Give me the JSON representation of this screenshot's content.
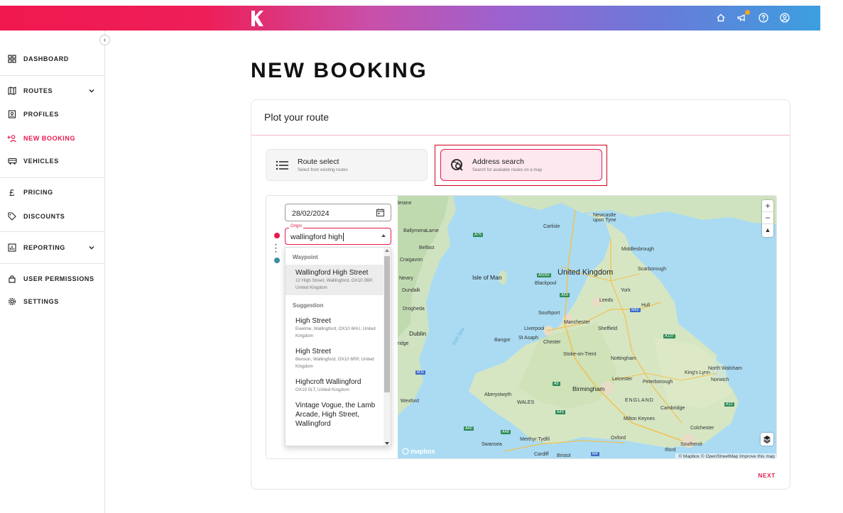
{
  "topbar": {
    "logo_letter": "K",
    "icons": [
      "home-icon",
      "megaphone-icon",
      "help-icon",
      "account-icon"
    ]
  },
  "sidebar": {
    "collapse_icon": "chevron-left-icon",
    "items": [
      {
        "label": "DASHBOARD",
        "icon": "dashboard-icon"
      },
      {
        "label": "ROUTES",
        "icon": "map-icon",
        "expandable": true
      },
      {
        "label": "PROFILES",
        "icon": "profile-icon"
      },
      {
        "label": "NEW BOOKING",
        "icon": "add-user-icon",
        "active": true
      },
      {
        "label": "VEHICLES",
        "icon": "bus-icon"
      },
      {
        "label": "PRICING",
        "icon": "pound-icon"
      },
      {
        "label": "DISCOUNTS",
        "icon": "tag-icon"
      },
      {
        "label": "REPORTING",
        "icon": "report-icon",
        "expandable": true
      },
      {
        "label": "USER PERMISSIONS",
        "icon": "lock-icon"
      },
      {
        "label": "SETTINGS",
        "icon": "gear-icon"
      }
    ]
  },
  "page": {
    "title": "NEW BOOKING"
  },
  "card": {
    "heading": "Plot your route",
    "options": {
      "route_select": {
        "title": "Route select",
        "subtitle": "Select from existing routes"
      },
      "address_search": {
        "title": "Address search",
        "subtitle": "Search for available routes on a map",
        "selected": true
      }
    },
    "next_label": "NEXT"
  },
  "form": {
    "date_value": "28/02/2024",
    "origin_label": "Origin",
    "origin_value": "wallingford high"
  },
  "dropdown": {
    "group_waypoint": "Waypoint",
    "waypoint": {
      "main": "Wallingford High Street",
      "sub": "12 High Street, Wallingford, OX10 0BP, United Kingdom"
    },
    "group_suggestion": "Suggestion",
    "suggestions": [
      {
        "main": "High Street",
        "sub": "Ewelme, Wallingford, OX10 6HU, United Kingdom"
      },
      {
        "main": "High Street",
        "sub": "Benson, Wallingford, OX10 6RP, United Kingdom"
      },
      {
        "main": "Highcroft Wallingford",
        "sub": "OX10 0LT, United Kingdom"
      },
      {
        "main": "Vintage Vogue, the Lamb Arcade, High Street, Wallingford",
        "sub": ""
      }
    ]
  },
  "map": {
    "labels": {
      "country": "United Kingdom",
      "isle_of_man": "Isle of Man",
      "irish_sea": "Irish Sea",
      "dublin": "Dublin",
      "birmingham": "Birmingham",
      "manchester": "Manchester",
      "liverpool": "Liverpool",
      "leeds": "Leeds",
      "york": "York",
      "sheffield": "Sheffield",
      "hull": "Hull",
      "newcastle": "Newcastle upon Tyne",
      "carlisle": "Carlisle",
      "middlesbrough": "Middlesbrough",
      "scarborough": "Scarborough",
      "blackpool": "Blackpool",
      "southport": "Southport",
      "belfast": "Belfast",
      "ballymena": "Ballymena",
      "larne": "Larne",
      "craigavon": "Craigavon",
      "newry": "Newry",
      "dundalk": "Dundalk",
      "drogheda": "Drogheda",
      "wexford": "Wexford",
      "bangor": "Bangor",
      "st_asaph": "St Asaph",
      "chester": "Chester",
      "stoke": "Stoke-on-Trent",
      "nottingham": "Nottingham",
      "leicester": "Leicester",
      "peterborough": "Peterborough",
      "kings_lynn": "King's Lynn",
      "norwich": "Norwich",
      "north_walsham": "North Walsham",
      "cambridge": "Cambridge",
      "milton_keynes": "Milton Keynes",
      "colchester": "Colchester",
      "oxford": "Oxford",
      "aberystwyth": "Aberystwyth",
      "wales": "WALES",
      "england": "ENGLAND",
      "swansea": "Swansea",
      "cardiff": "Cardiff",
      "bristol": "Bristol",
      "merthyr": "Merthyr Tydfil",
      "southend": "Southend-",
      "ilford": "Ilford",
      "lerane": "lerane",
      "ridge": "ridge"
    },
    "roads": [
      "A75",
      "A5092",
      "A59",
      "M62",
      "A137",
      "M11",
      "A5",
      "A49",
      "A40",
      "A48",
      "M4",
      "A12",
      "A5"
    ],
    "mapbox_brand": "mapbox",
    "attribution": "© Mapbox © OpenStreetMap Improve this map"
  }
}
